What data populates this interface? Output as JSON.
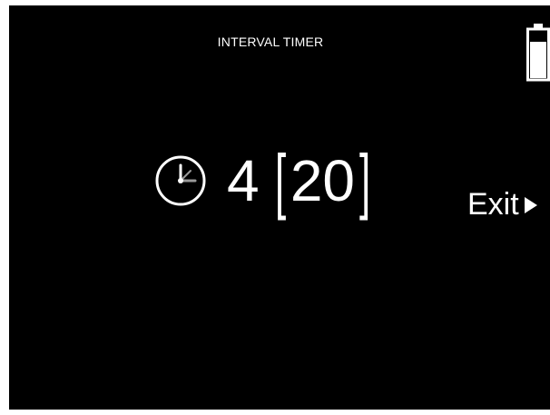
{
  "header": {
    "title": "INTERVAL TIMER"
  },
  "status": {
    "battery_icon": "battery-icon"
  },
  "timer": {
    "clock_icon": "clock-icon",
    "rounds": "4",
    "bracket_open": "[",
    "interval_seconds": "20",
    "bracket_close": "]"
  },
  "actions": {
    "exit_label": "Exit",
    "exit_icon": "play-arrow-icon"
  },
  "colors": {
    "background": "#000000",
    "foreground": "#ffffff",
    "clock_hand_secondary": "#9a9a9a"
  }
}
